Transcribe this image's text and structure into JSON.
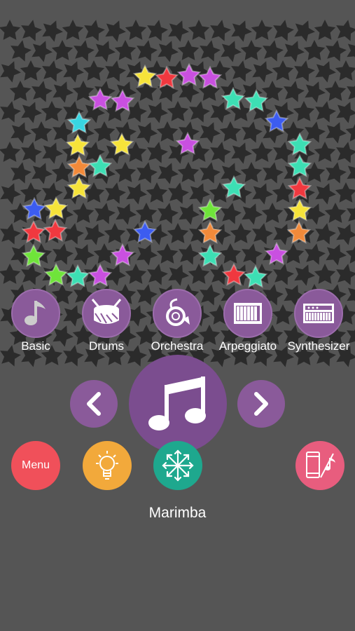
{
  "categories": [
    {
      "id": "basic",
      "label": "Basic",
      "icon": "music-note-icon"
    },
    {
      "id": "drums",
      "label": "Drums",
      "icon": "drum-icon"
    },
    {
      "id": "orchestra",
      "label": "Orchestra",
      "icon": "french-horn-icon"
    },
    {
      "id": "arpeggiato",
      "label": "Arpeggiato",
      "icon": "piano-keys-icon"
    },
    {
      "id": "synthesizer",
      "label": "Synthesizer",
      "icon": "synthesizer-icon"
    }
  ],
  "controls": {
    "prev_icon": "chevron-left-icon",
    "center_icon": "music-note-icon",
    "next_icon": "chevron-right-icon"
  },
  "bottom": {
    "menu_label": "Menu",
    "menu_color": "#f0505a",
    "hint_color": "#f2a93b",
    "spread_color": "#1ea88e",
    "share_color": "#e85d7e"
  },
  "instrument_name": "Marimba",
  "colors": {
    "background": "#555555",
    "star_pattern": "#2b2b2b",
    "purple": "#8a5a9a",
    "purple_dark": "#7b4d8f"
  }
}
